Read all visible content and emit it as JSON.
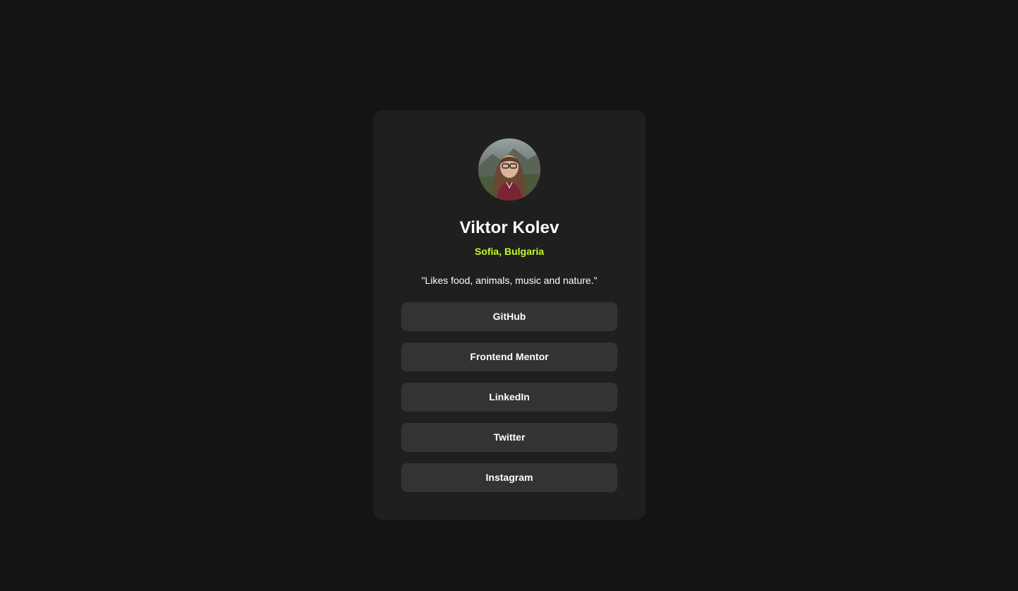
{
  "profile": {
    "name": "Viktor Kolev",
    "location": "Sofia, Bulgaria",
    "bio": "\"Likes food, animals, music and nature.\""
  },
  "links": [
    {
      "label": "GitHub"
    },
    {
      "label": "Frontend Mentor"
    },
    {
      "label": "LinkedIn"
    },
    {
      "label": "Twitter"
    },
    {
      "label": "Instagram"
    }
  ],
  "colors": {
    "page_background": "#141414",
    "card_background": "#1f1f1f",
    "button_background": "#333333",
    "accent": "#c4f82a",
    "text": "#ffffff"
  }
}
